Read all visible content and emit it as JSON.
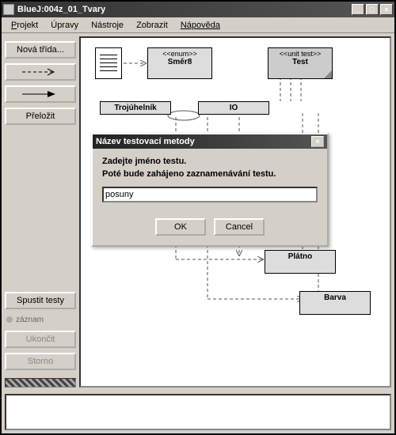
{
  "title": "BlueJ:004z_01_Tvary",
  "menu": {
    "projekt": "Projekt",
    "upravy": "Úpravy",
    "nastroje": "Nástroje",
    "zobrazit": "Zobrazit",
    "napoveda": "Nápověda"
  },
  "left": {
    "nova_trida": "Nová třída...",
    "prelozit": "Přeložit",
    "spustit_testy": "Spustit testy",
    "zaznam": "záznam",
    "ukoncit": "Ukončit",
    "storno": "Storno"
  },
  "classes": {
    "smer8": {
      "stereo": "<<enum>>",
      "name": "Směr8"
    },
    "test": {
      "stereo": "<<unit test>>",
      "name": "Test"
    },
    "trojuhelnik": {
      "name": "Trojúhelník"
    },
    "io": {
      "name": "IO"
    },
    "platno": {
      "name": "Plátno"
    },
    "barva": {
      "name": "Barva"
    }
  },
  "dialog": {
    "title": "Název testovací metody",
    "line1": "Zadejte jméno testu.",
    "line2": "Poté bude zahájeno zaznamenávání testu.",
    "value": "posuny",
    "ok": "OK",
    "cancel": "Cancel"
  }
}
